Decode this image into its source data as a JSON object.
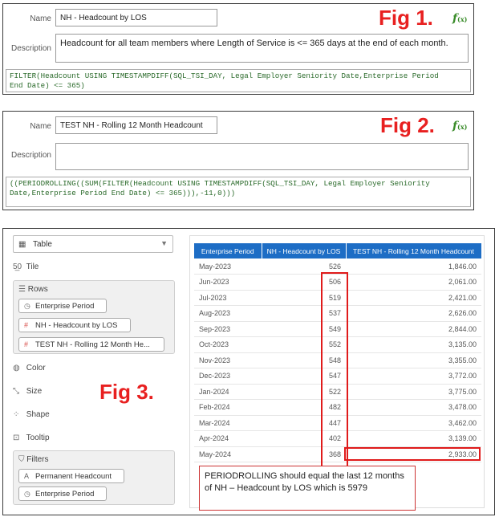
{
  "fig1": {
    "name_label": "Name",
    "name_value": "NH - Headcount by LOS",
    "desc_label": "Description",
    "desc_value": "Headcount for all team members where Length of Service is <= 365 days at the end of each month.",
    "fig_label": "Fig 1.",
    "formula_line1": "FILTER(Headcount USING TIMESTAMPDIFF(SQL_TSI_DAY, Legal Employer Seniority Date,Enterprise Period",
    "formula_line2": "End Date) <= 365)"
  },
  "fig2": {
    "name_label": "Name",
    "name_value": "TEST NH - Rolling 12 Month Headcount",
    "desc_label": "Description",
    "desc_value": "",
    "fig_label": "Fig 2.",
    "formula_line1": "((PERIODROLLING((SUM(FILTER(Headcount USING TIMESTAMPDIFF(SQL_TSI_DAY, Legal Employer Seniority",
    "formula_line2": "Date,Enterprise Period End Date) <= 365))),-11,0)))"
  },
  "fig3": {
    "fig_label": "Fig 3.",
    "viz_type": "Table",
    "shelves": {
      "tile": "Tile",
      "rows": "Rows",
      "color": "Color",
      "size": "Size",
      "shape": "Shape",
      "tooltip": "Tooltip",
      "filters": "Filters"
    },
    "row_pills": [
      "Enterprise Period",
      "NH - Headcount by LOS",
      "TEST NH - Rolling 12 Month He..."
    ],
    "filter_pills": [
      "Permanent Headcount",
      "Enterprise Period"
    ],
    "table": {
      "headers": [
        "Enterprise Period",
        "NH - Headcount by LOS",
        "TEST NH - Rolling 12 Month Headcount"
      ],
      "rows": [
        [
          "May-2023",
          "526",
          "1,846.00"
        ],
        [
          "Jun-2023",
          "506",
          "2,061.00"
        ],
        [
          "Jul-2023",
          "519",
          "2,421.00"
        ],
        [
          "Aug-2023",
          "537",
          "2,626.00"
        ],
        [
          "Sep-2023",
          "549",
          "2,844.00"
        ],
        [
          "Oct-2023",
          "552",
          "3,135.00"
        ],
        [
          "Nov-2023",
          "548",
          "3,355.00"
        ],
        [
          "Dec-2023",
          "547",
          "3,772.00"
        ],
        [
          "Jan-2024",
          "522",
          "3,775.00"
        ],
        [
          "Feb-2024",
          "482",
          "3,478.00"
        ],
        [
          "Mar-2024",
          "447",
          "3,462.00"
        ],
        [
          "Apr-2024",
          "402",
          "3,139.00"
        ],
        [
          "May-2024",
          "368",
          "2,933.00"
        ]
      ]
    },
    "callout": "PERIODROLLING should equal the last 12 months of NH – Headcount by LOS which is 5979"
  },
  "colors": {
    "header_blue": "#1d6dc5",
    "annotation_red": "#e01b1b",
    "fx_green": "#3a8c2a"
  }
}
